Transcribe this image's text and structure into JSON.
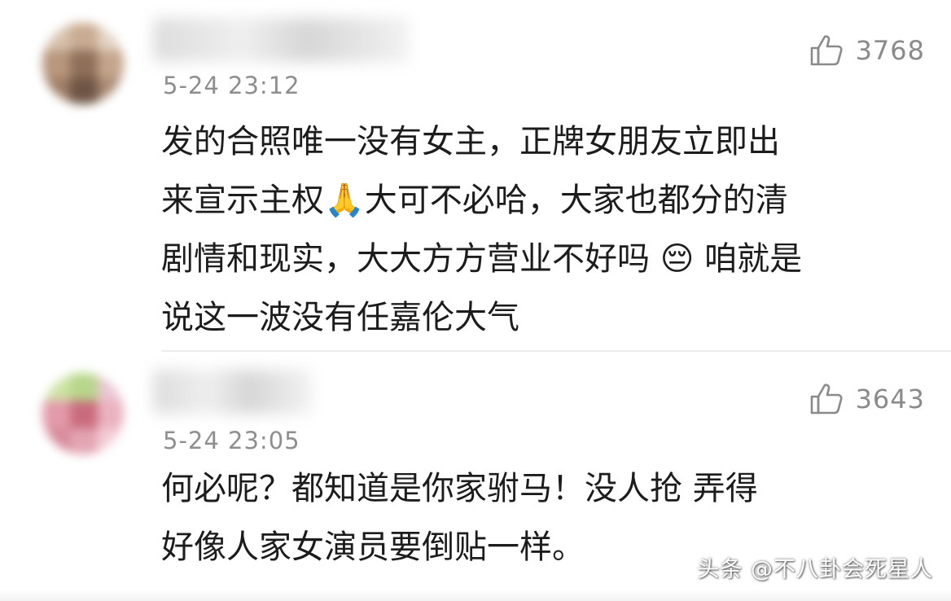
{
  "comments": [
    {
      "username": "",
      "time": "5-24 23:12",
      "like_count": "3768",
      "like_icon": "thumbs-up-icon",
      "lines": [
        "发的合照唯一没有女主，正牌女朋友立即出",
        "来宣示主权🙏大可不必哈，大家也都分的清",
        "剧情和现实，大大方方营业不好吗 😔 咱就是",
        "说这一波没有任嘉伦大气"
      ]
    },
    {
      "username": "",
      "time": "5-24 23:05",
      "like_count": "3643",
      "like_icon": "thumbs-up-icon",
      "lines": [
        "何必呢？都知道是你家驸马！没人抢 弄得",
        "好像人家女演员要倒贴一样。"
      ]
    }
  ],
  "watermark": "头条 @不八卦会死星人",
  "colors": {
    "text": "#1c1c1c",
    "meta": "#8e8e8e",
    "divider": "#ececec",
    "background": "#ffffff"
  }
}
